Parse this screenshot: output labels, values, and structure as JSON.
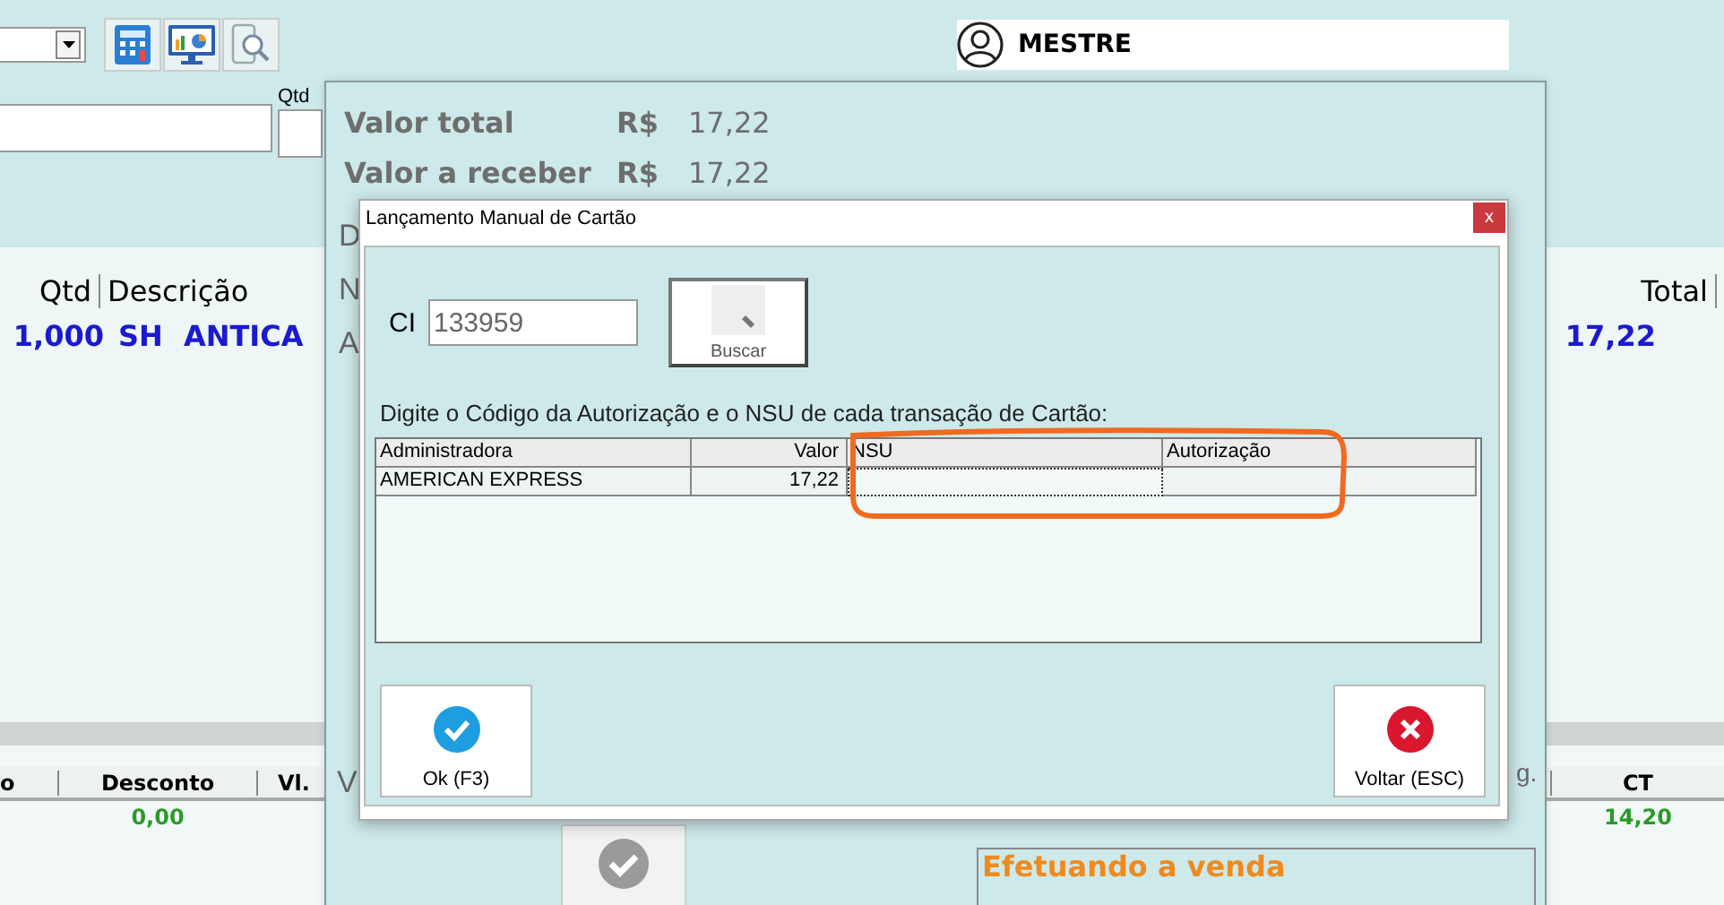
{
  "user": {
    "name": "MESTRE"
  },
  "qty_label": "Qtd",
  "items_grid": {
    "columns": [
      {
        "label": "Qtd",
        "kind": "qty"
      },
      {
        "label": "Descrição",
        "kind": "desc"
      },
      {
        "label": "Total",
        "kind": "total"
      }
    ],
    "rows": [
      {
        "qty": "1,000",
        "description": "SH ANTICA",
        "total": "17,22"
      }
    ]
  },
  "totals_grid": {
    "columns": [
      {
        "label": "o",
        "kind": "cut"
      },
      {
        "label": "Desconto",
        "kind": "mid",
        "value": "0,00"
      },
      {
        "label": "Vl.",
        "kind": "cut2"
      },
      {
        "label": "CT",
        "kind": "right",
        "value": "14,20"
      }
    ]
  },
  "payment": {
    "amounts": [
      {
        "label": "Valor total",
        "currency": "R$",
        "amount": "17,22"
      },
      {
        "label": "Valor a receber",
        "currency": "R$",
        "amount": "17,22"
      }
    ],
    "side_letters": [
      "D",
      "N",
      "A"
    ],
    "lower_left_label": "V",
    "lower_right_label": "g.",
    "status": "Efetuando a venda"
  },
  "dialog": {
    "title": "Lançamento Manual de Cartão",
    "close": "x",
    "ci_label": "CI",
    "ci_value": "133959",
    "search_button": "Buscar",
    "instruction": "Digite o Código da Autorização e o NSU de cada transação de Cartão:",
    "table": {
      "columns": [
        "Administradora",
        "Valor",
        "NSU",
        "Autorização"
      ],
      "rows": [
        {
          "administradora": "AMERICAN EXPRESS",
          "valor": "17,22",
          "nsu_focused": true
        }
      ]
    },
    "buttons": [
      {
        "label": "Ok (F3)",
        "kind": "ok"
      },
      {
        "label": "Voltar (ESC)",
        "kind": "back"
      }
    ]
  }
}
